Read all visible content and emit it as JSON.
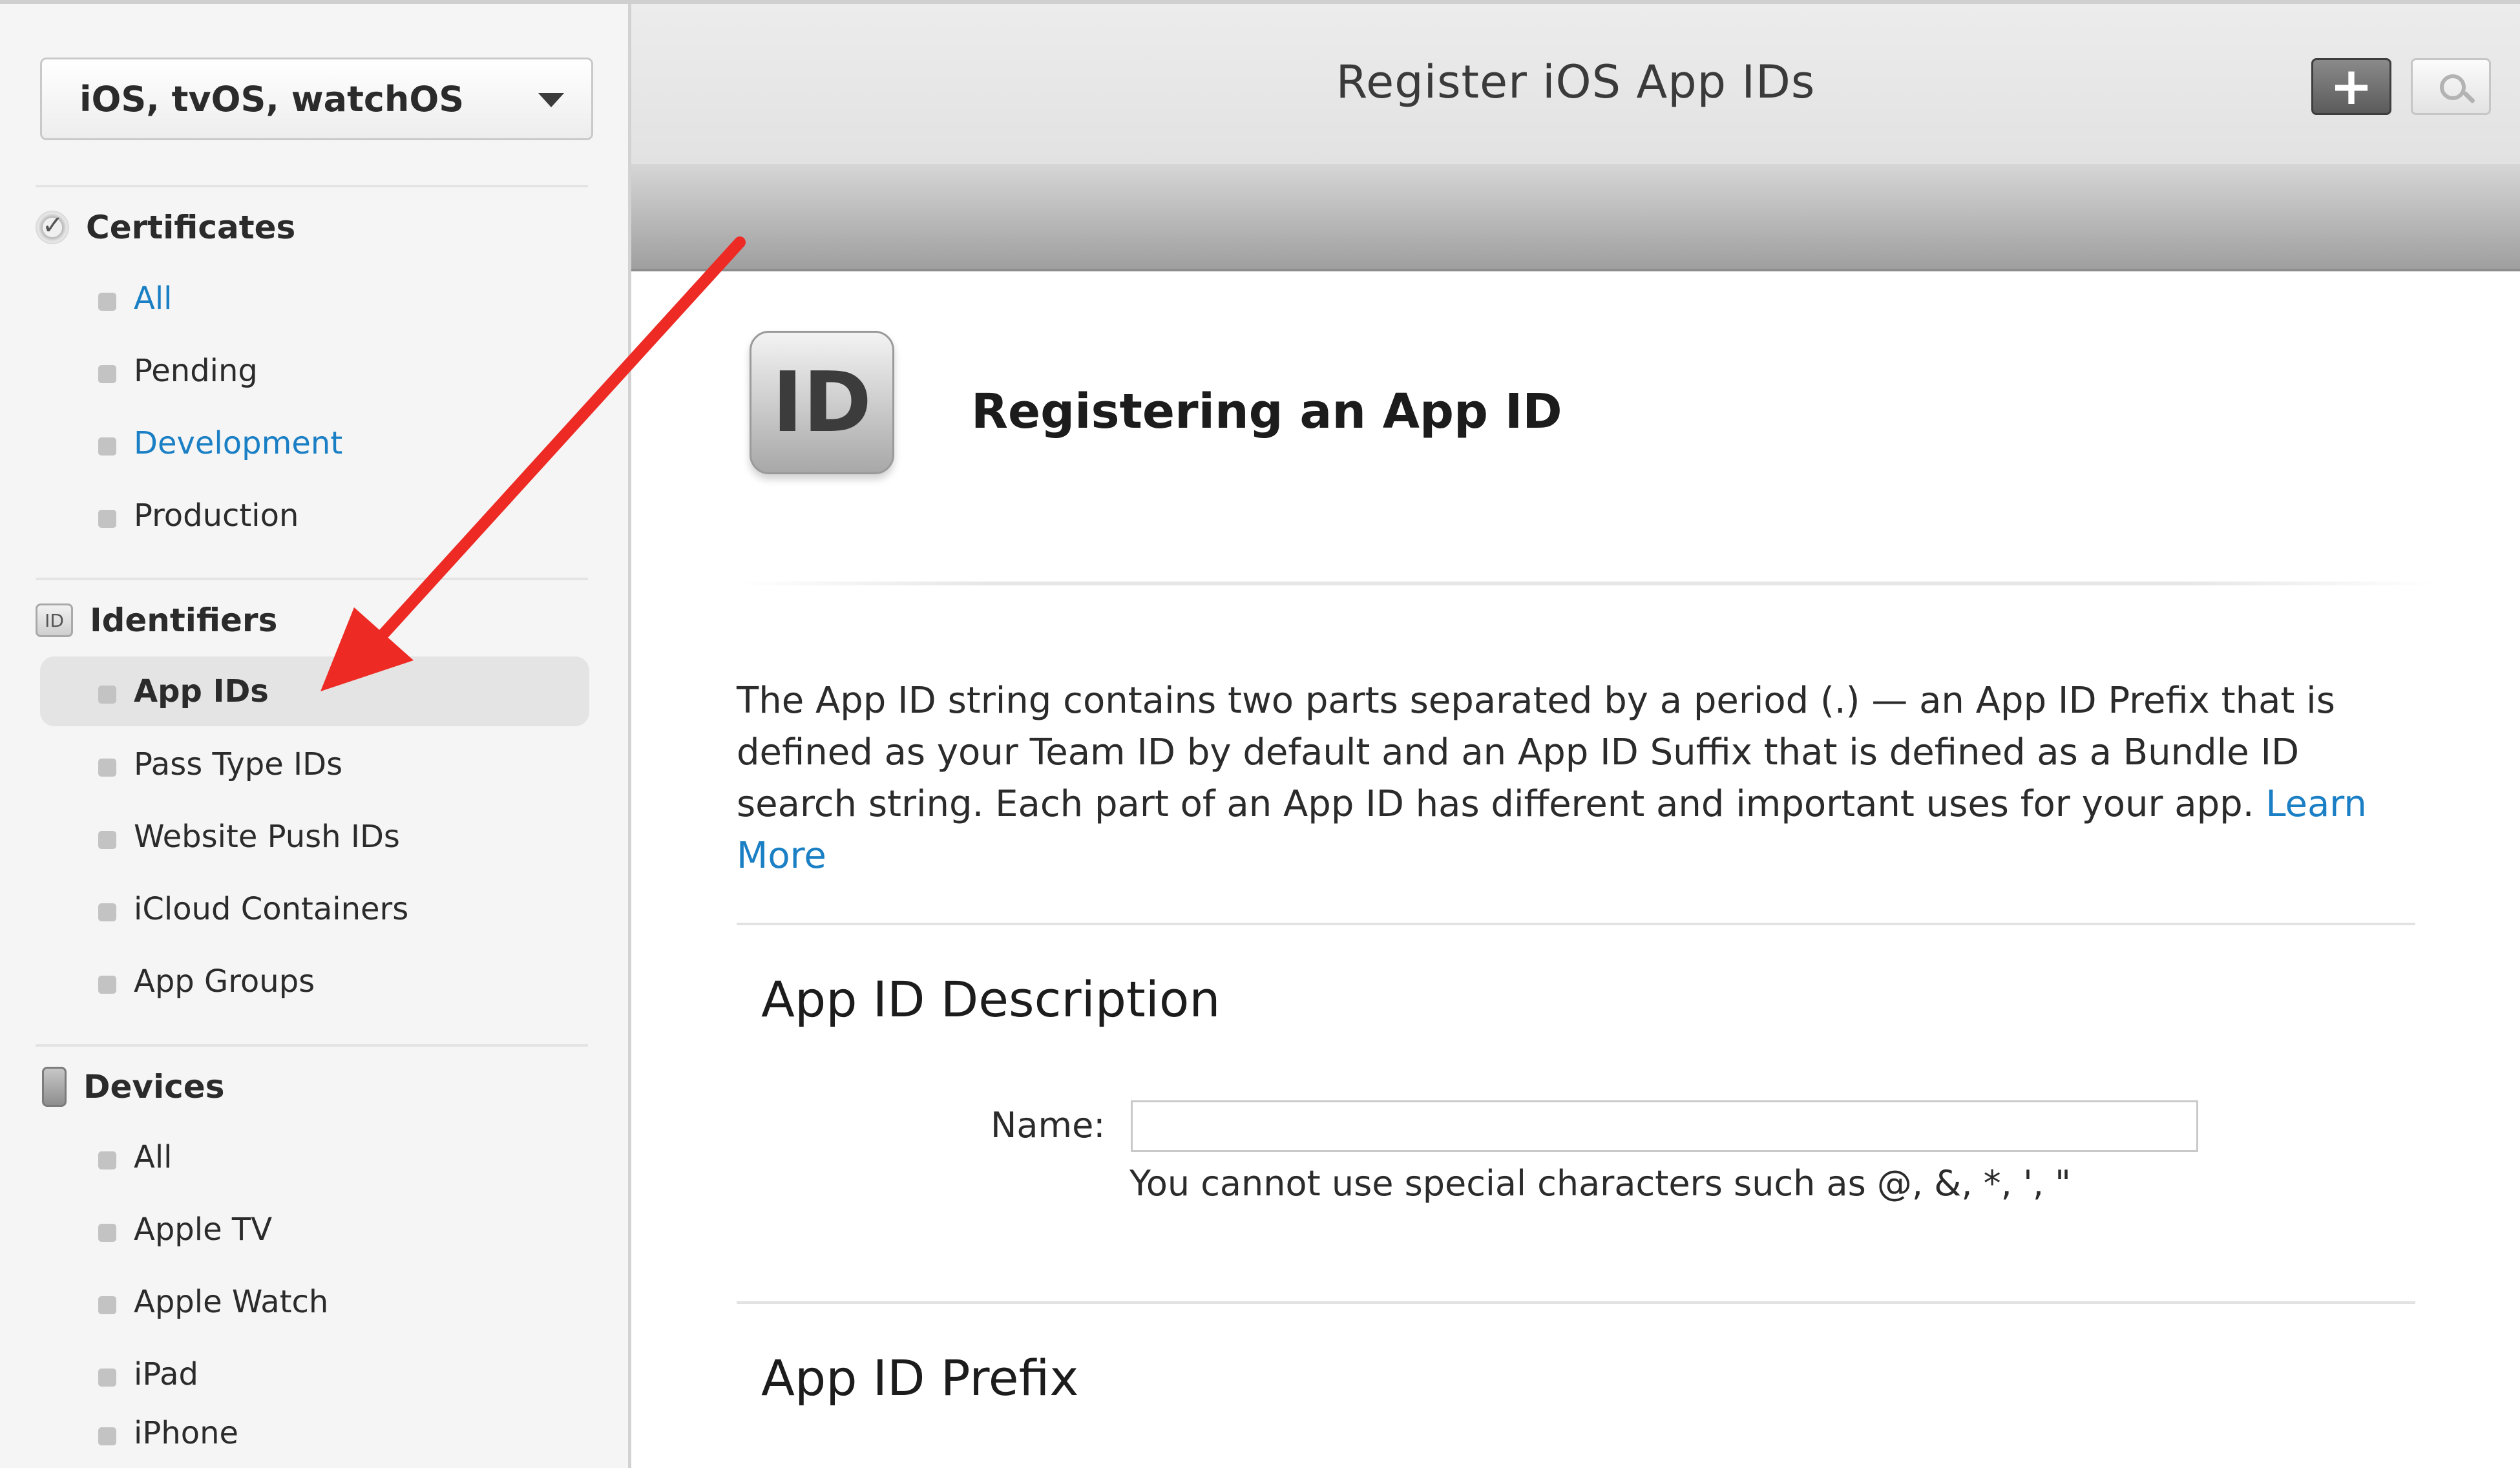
{
  "header": {
    "title": "Register iOS App IDs",
    "add_symbol": "+"
  },
  "sidebar": {
    "platform": "iOS, tvOS, watchOS",
    "sections": {
      "certificates": {
        "label": "Certificates",
        "items": [
          "All",
          "Pending",
          "Development",
          "Production"
        ]
      },
      "identifiers": {
        "label": "Identifiers",
        "icon_text": "ID",
        "items": [
          "App IDs",
          "Pass Type IDs",
          "Website Push IDs",
          "iCloud Containers",
          "App Groups"
        ]
      },
      "devices": {
        "label": "Devices",
        "items": [
          "All",
          "Apple TV",
          "Apple Watch",
          "iPad",
          "iPhone"
        ]
      }
    }
  },
  "main": {
    "badge_text": "ID",
    "heading": "Registering an App ID",
    "intro": "The App ID string contains two parts separated by a period (.) — an App ID Prefix that is defined as your Team ID by default and an App ID Suffix that is defined as a Bundle ID search string. Each part of an App ID has different and important uses for your app.",
    "learn_more": "Learn More",
    "description_section": {
      "title": "App ID Description",
      "name_label": "Name:",
      "name_value": "",
      "hint": "You cannot use special characters such as @, &, *, ', \""
    },
    "prefix_section": {
      "title": "App ID Prefix"
    }
  },
  "colors": {
    "link": "#1a7fc4",
    "annotation_arrow": "#ee2a24",
    "toolbar_band": "#a9a9a9"
  },
  "icons": [
    "certificate-icon",
    "id-icon",
    "device-icon",
    "plus-icon",
    "search-icon",
    "chevron-down-icon"
  ]
}
